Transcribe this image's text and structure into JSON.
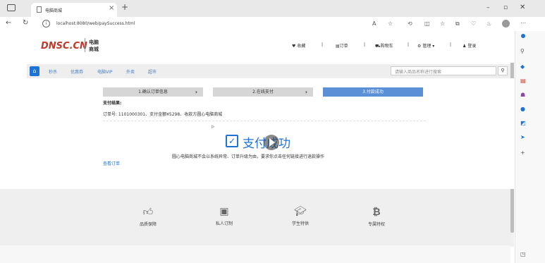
{
  "browser": {
    "tab_title": "电脑商城",
    "new_tab": "+",
    "url": "localhost:8080/web/paySuccess.html",
    "url_host": "localhost",
    "icons": [
      "back-icon",
      "refresh-icon",
      "info-icon",
      "read-aloud-icon",
      "favorite-icon",
      "extensions-icon",
      "collections-icon",
      "split-screen-icon",
      "history-icon",
      "settings-icon",
      "profile-icon"
    ],
    "window_controls": [
      "–",
      "□",
      "✕"
    ]
  },
  "site": {
    "logo": "DNSC.CN",
    "logo_sub1": "电脑",
    "logo_sub2": "商城",
    "topnav": {
      "favorites": "收藏",
      "orders": "订单",
      "cart": "购物车",
      "manage": "管理",
      "login": "登录"
    }
  },
  "nav": {
    "items": [
      "秒杀",
      "优惠券",
      "电脑VIP",
      "外卖",
      "超市"
    ],
    "search_placeholder": "请输入商品名称进行搜索"
  },
  "steps": [
    {
      "label": "1.确认订单信息",
      "active": false
    },
    {
      "label": "2.在线支付",
      "active": false
    },
    {
      "label": "3.付款成功",
      "active": true
    }
  ],
  "result": {
    "heading": "支付结果:",
    "detail": "订单号: 1101000301、支付金额¥5298、收款方圆心电脑商城",
    "success_text": "支付成功",
    "notice": "圆心电脑商城不会以系统异常、订单升级为由，要求你点击任何链接进行退款操作",
    "view_order": "查看订单"
  },
  "footer": {
    "items": [
      {
        "icon": "thumbs-up-icon",
        "label": "品质保障"
      },
      {
        "icon": "id-card-icon",
        "label": "私人订制"
      },
      {
        "icon": "graduation-cap-icon",
        "label": "学生特供"
      },
      {
        "icon": "bitcoin-icon",
        "label": "专属特权"
      }
    ]
  },
  "colors": {
    "accent": "#1e73d6",
    "step_inactive": "#d6d6d6",
    "step_active": "#5b8fd6",
    "nav_bg": "#eeeeee",
    "footer_bg": "#efefef"
  }
}
